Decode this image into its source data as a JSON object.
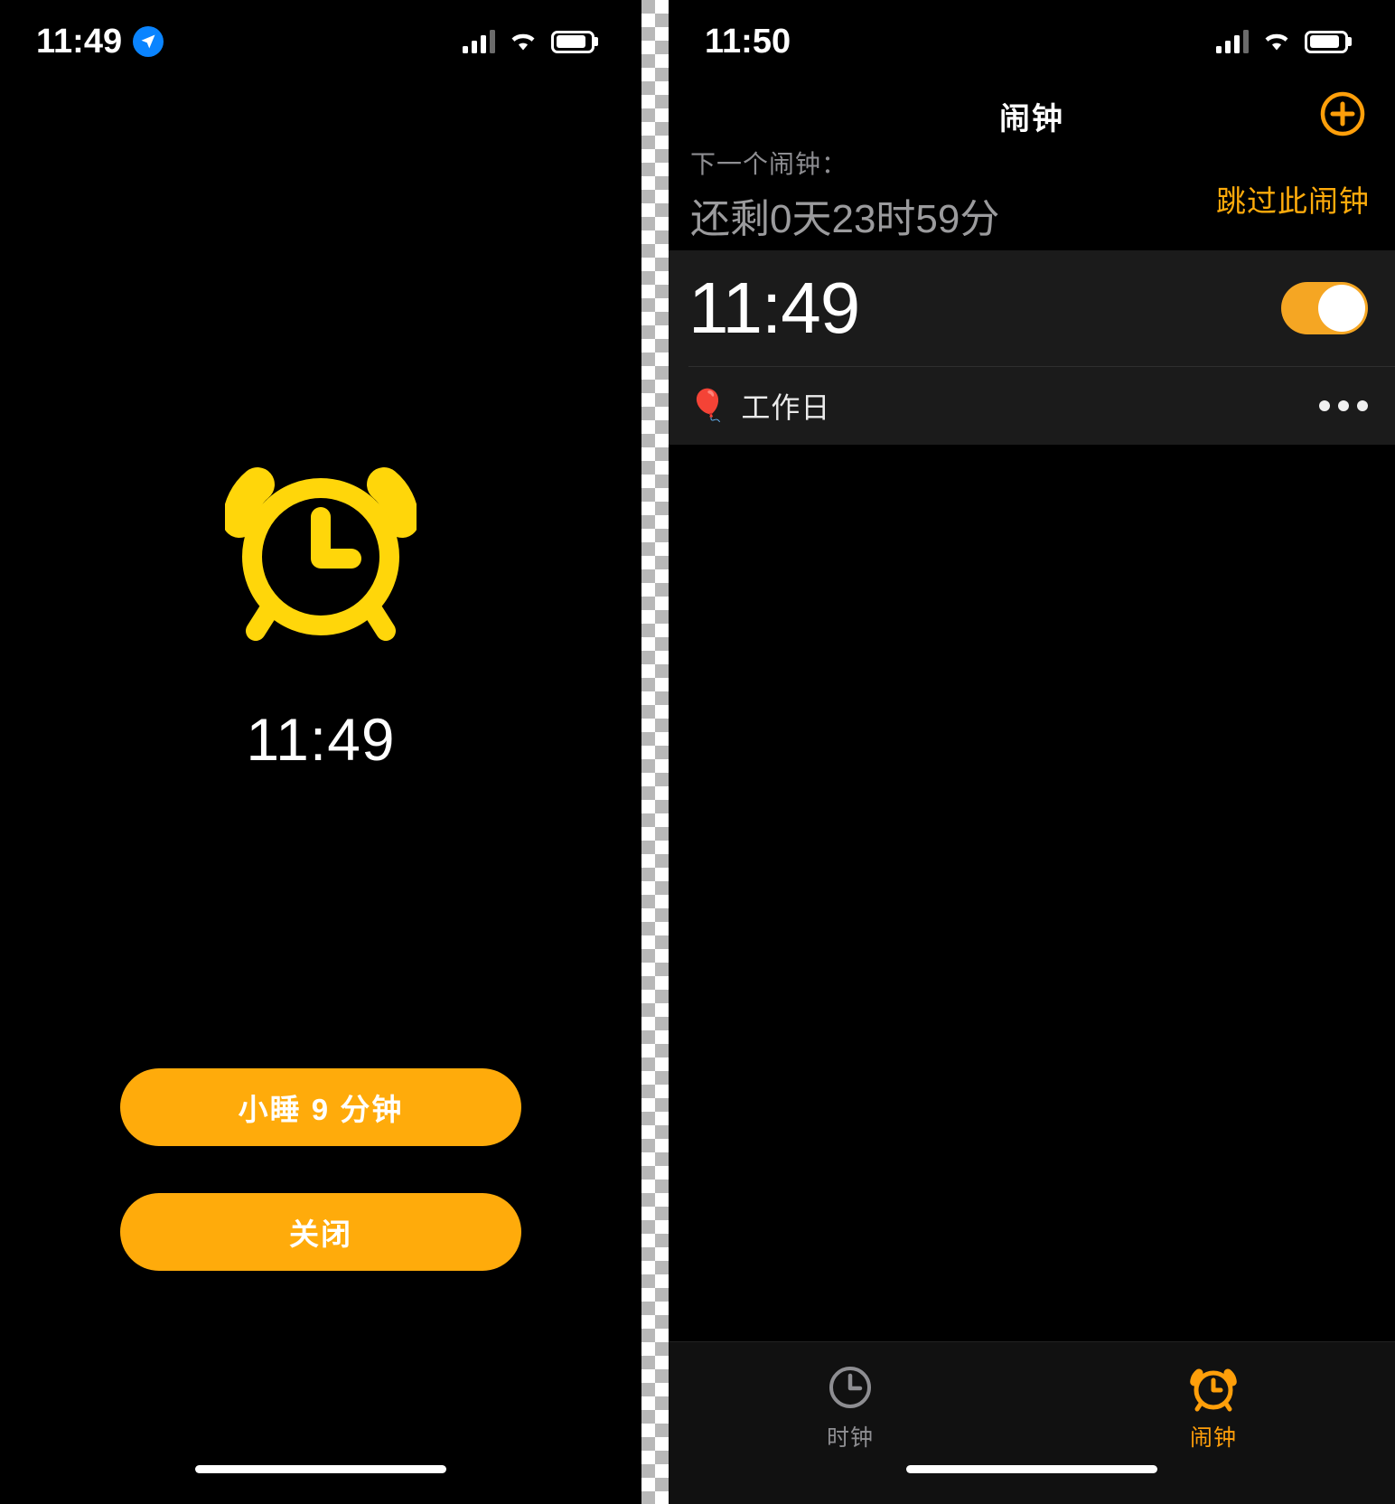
{
  "left_panel": {
    "status_bar": {
      "time": "11:49",
      "location_icon": "location-arrow-icon",
      "signal_icon": "cellular-bars-icon",
      "wifi_icon": "wifi-icon",
      "battery_icon": "battery-icon"
    },
    "alarm_icon": "alarm-clock-icon",
    "fire_time": "11:49",
    "snooze_button": "小睡 9 分钟",
    "stop_button": "关闭",
    "accent_color": "#ffab0b"
  },
  "right_panel": {
    "status_bar": {
      "time": "11:50",
      "signal_icon": "cellular-bars-icon",
      "wifi_icon": "wifi-icon",
      "battery_icon": "battery-icon"
    },
    "nav": {
      "title": "闹钟",
      "add_icon": "plus-circle-icon"
    },
    "next_alarm": {
      "label": "下一个闹钟：",
      "value": "还剩0天23时59分",
      "skip_link": "跳过此闹钟"
    },
    "alarm": {
      "time": "11:49",
      "enabled": true,
      "tag_icon": "balloon-emoji",
      "tag_emoji": "🎈",
      "tag_label": "工作日",
      "more_icon": "more-dots-icon"
    },
    "tabs": [
      {
        "label": "时钟",
        "icon": "clock-icon",
        "active": false
      },
      {
        "label": "闹钟",
        "icon": "alarm-clock-icon",
        "active": true
      }
    ],
    "accent_color": "#ff9f0a",
    "toggle_color": "#f5a623"
  }
}
